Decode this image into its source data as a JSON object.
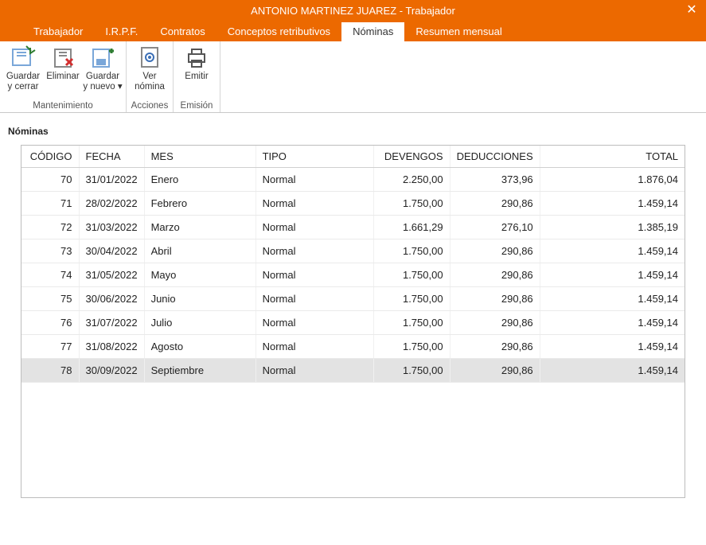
{
  "window": {
    "title": "ANTONIO MARTINEZ JUAREZ - Trabajador"
  },
  "tabs": [
    {
      "label": "Trabajador"
    },
    {
      "label": "I.R.P.F."
    },
    {
      "label": "Contratos"
    },
    {
      "label": "Conceptos retributivos"
    },
    {
      "label": "Nóminas"
    },
    {
      "label": "Resumen mensual"
    }
  ],
  "active_tab_index": 4,
  "ribbon": {
    "groups": [
      {
        "label": "Mantenimiento",
        "buttons": [
          {
            "l1": "Guardar",
            "l2": "y cerrar",
            "icon": "save-close"
          },
          {
            "l1": "Eliminar",
            "l2": "",
            "icon": "delete"
          },
          {
            "l1": "Guardar",
            "l2": "y nuevo ▾",
            "icon": "save-new"
          }
        ]
      },
      {
        "label": "Acciones",
        "buttons": [
          {
            "l1": "Ver",
            "l2": "nómina",
            "icon": "preview"
          }
        ]
      },
      {
        "label": "Emisión",
        "buttons": [
          {
            "l1": "Emitir",
            "l2": "",
            "icon": "print"
          }
        ]
      }
    ]
  },
  "section_label": "Nóminas",
  "columns": {
    "codigo": "CÓDIGO",
    "fecha": "FECHA",
    "mes": "MES",
    "tipo": "TIPO",
    "devengos": "DEVENGOS",
    "deducciones": "DEDUCCIONES",
    "total": "TOTAL"
  },
  "rows": [
    {
      "codigo": "70",
      "fecha": "31/01/2022",
      "mes": "Enero",
      "tipo": "Normal",
      "devengos": "2.250,00",
      "deducciones": "373,96",
      "total": "1.876,04"
    },
    {
      "codigo": "71",
      "fecha": "28/02/2022",
      "mes": "Febrero",
      "tipo": "Normal",
      "devengos": "1.750,00",
      "deducciones": "290,86",
      "total": "1.459,14"
    },
    {
      "codigo": "72",
      "fecha": "31/03/2022",
      "mes": "Marzo",
      "tipo": "Normal",
      "devengos": "1.661,29",
      "deducciones": "276,10",
      "total": "1.385,19"
    },
    {
      "codigo": "73",
      "fecha": "30/04/2022",
      "mes": "Abril",
      "tipo": "Normal",
      "devengos": "1.750,00",
      "deducciones": "290,86",
      "total": "1.459,14"
    },
    {
      "codigo": "74",
      "fecha": "31/05/2022",
      "mes": "Mayo",
      "tipo": "Normal",
      "devengos": "1.750,00",
      "deducciones": "290,86",
      "total": "1.459,14"
    },
    {
      "codigo": "75",
      "fecha": "30/06/2022",
      "mes": "Junio",
      "tipo": "Normal",
      "devengos": "1.750,00",
      "deducciones": "290,86",
      "total": "1.459,14"
    },
    {
      "codigo": "76",
      "fecha": "31/07/2022",
      "mes": "Julio",
      "tipo": "Normal",
      "devengos": "1.750,00",
      "deducciones": "290,86",
      "total": "1.459,14"
    },
    {
      "codigo": "77",
      "fecha": "31/08/2022",
      "mes": "Agosto",
      "tipo": "Normal",
      "devengos": "1.750,00",
      "deducciones": "290,86",
      "total": "1.459,14"
    },
    {
      "codigo": "78",
      "fecha": "30/09/2022",
      "mes": "Septiembre",
      "tipo": "Normal",
      "devengos": "1.750,00",
      "deducciones": "290,86",
      "total": "1.459,14"
    }
  ],
  "selected_row_index": 8
}
